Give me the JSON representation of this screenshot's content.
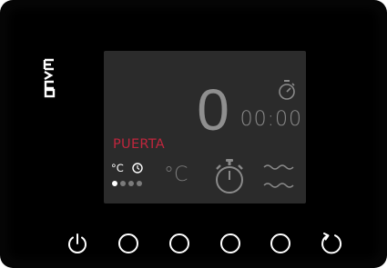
{
  "brand": "EVCO",
  "display": {
    "main_value": "0",
    "timer": "00:00",
    "status": "PUERTA",
    "unit": "°C",
    "mode_label": "°C",
    "page_indicator": {
      "total": 4,
      "active": 1
    }
  },
  "icons": {
    "logo": "evco-logo",
    "small_timer": "stopwatch-icon",
    "mode_clock": "clock-icon",
    "stopwatch": "stopwatch-icon",
    "waves": "waves-icon"
  },
  "buttons": [
    {
      "name": "power-button",
      "icon": "power-icon"
    },
    {
      "name": "key-1-button",
      "icon": "circle-icon"
    },
    {
      "name": "key-2-button",
      "icon": "circle-icon"
    },
    {
      "name": "key-3-button",
      "icon": "circle-icon"
    },
    {
      "name": "key-4-button",
      "icon": "circle-icon"
    },
    {
      "name": "refresh-button",
      "icon": "refresh-icon"
    }
  ],
  "colors": {
    "panel": "#050505",
    "screen": "#2b2b2b",
    "status_red": "#c0263d",
    "display_grey": "#8a8a8a"
  }
}
